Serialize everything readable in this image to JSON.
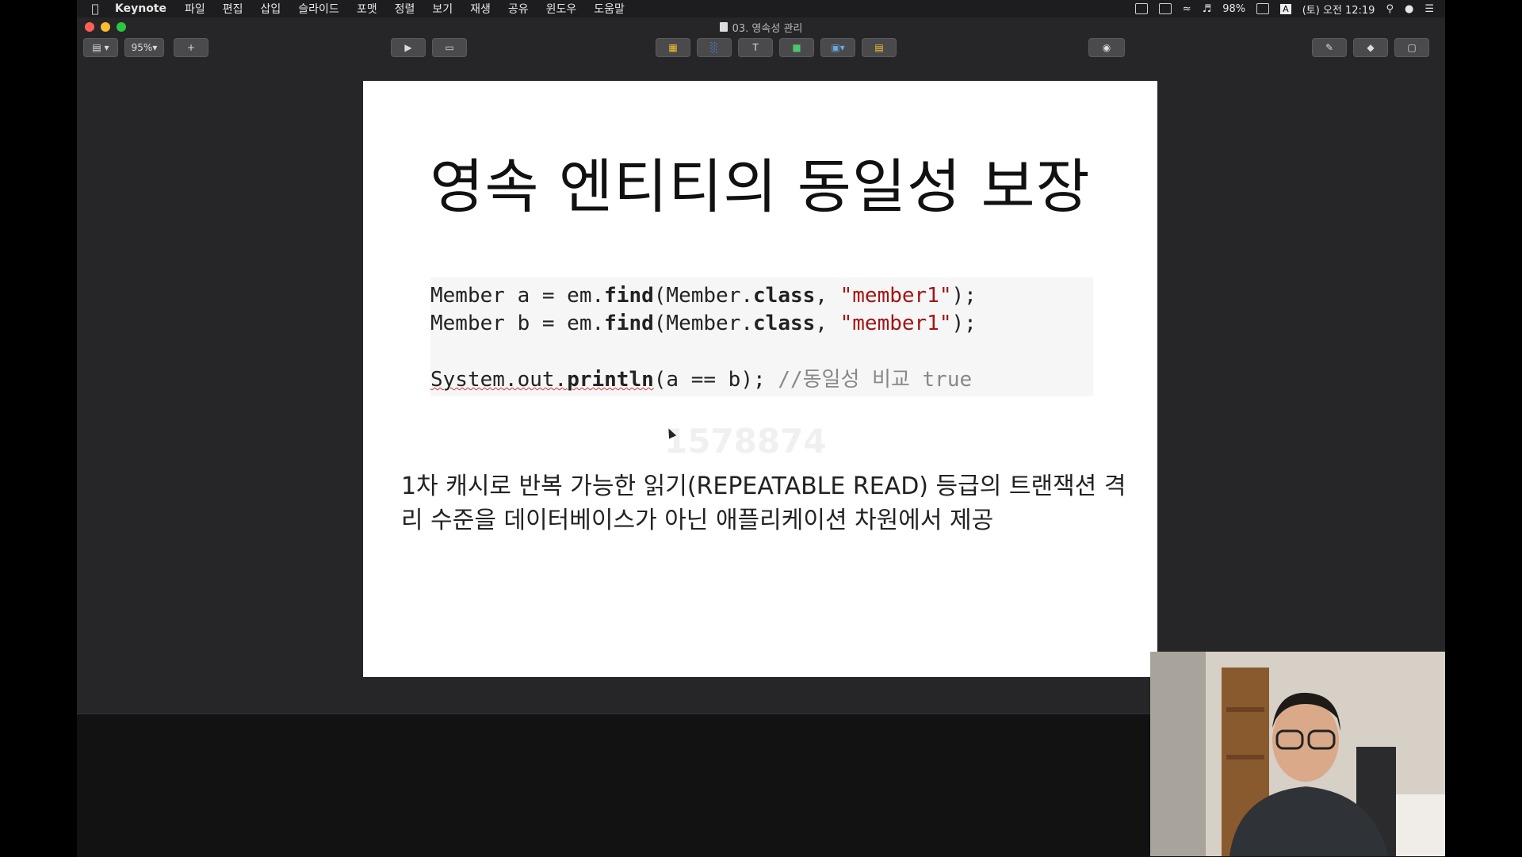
{
  "menubar": {
    "app": "Keynote",
    "items": [
      "파일",
      "편집",
      "삽입",
      "슬라이드",
      "포맷",
      "정렬",
      "보기",
      "재생",
      "공유",
      "윈도우",
      "도움말"
    ],
    "battery": "98%",
    "clock": "(토) 오전 12:19"
  },
  "window": {
    "title": "03. 영속성 관리"
  },
  "toolbar": {
    "zoom": "95%"
  },
  "slide": {
    "title": "영속 엔티티의 동일성 보장",
    "code": {
      "line1": {
        "a": "Member a = em.",
        "b": "find",
        "c": "(Member.",
        "d": "class",
        "e": ", ",
        "f": "\"member1\"",
        "g": ");"
      },
      "line2": {
        "a": "Member b = em.",
        "b": "find",
        "c": "(Member.",
        "d": "class",
        "e": ", ",
        "f": "\"member1\"",
        "g": ");"
      },
      "line3": {
        "a": "System.out.",
        "b": "println",
        "c": "(a == b); ",
        "d": "//동일성 비교 true"
      }
    },
    "description": "1차 캐시로 반복 가능한 읽기(REPEATABLE READ) 등급의 트랜잭션 격리 수준을 데이터베이스가 아닌 애플리케이션 차원에서 제공",
    "watermark": "1578874"
  }
}
